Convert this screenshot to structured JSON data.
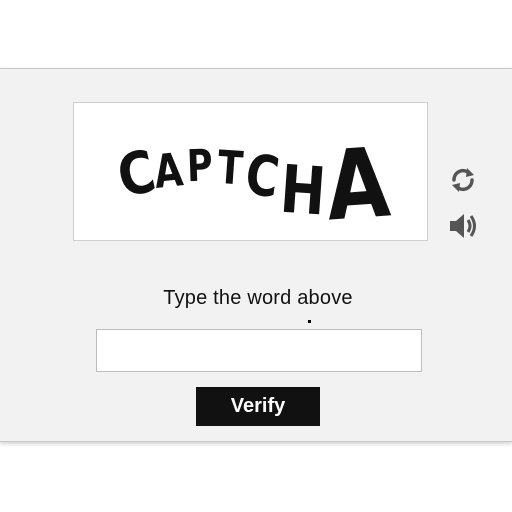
{
  "captcha": {
    "word": "CAPTCHA",
    "letters": [
      "C",
      "A",
      "P",
      "T",
      "C",
      "H",
      "A"
    ],
    "prompt": "Type the word above",
    "input_value": "",
    "verify_label": "Verify",
    "refresh_icon": "refresh-icon",
    "audio_icon": "speaker-audio-icon"
  },
  "colors": {
    "panel_background": "#f2f2f2",
    "button_background": "#111111",
    "button_text": "#ffffff",
    "icon": "#555555"
  }
}
